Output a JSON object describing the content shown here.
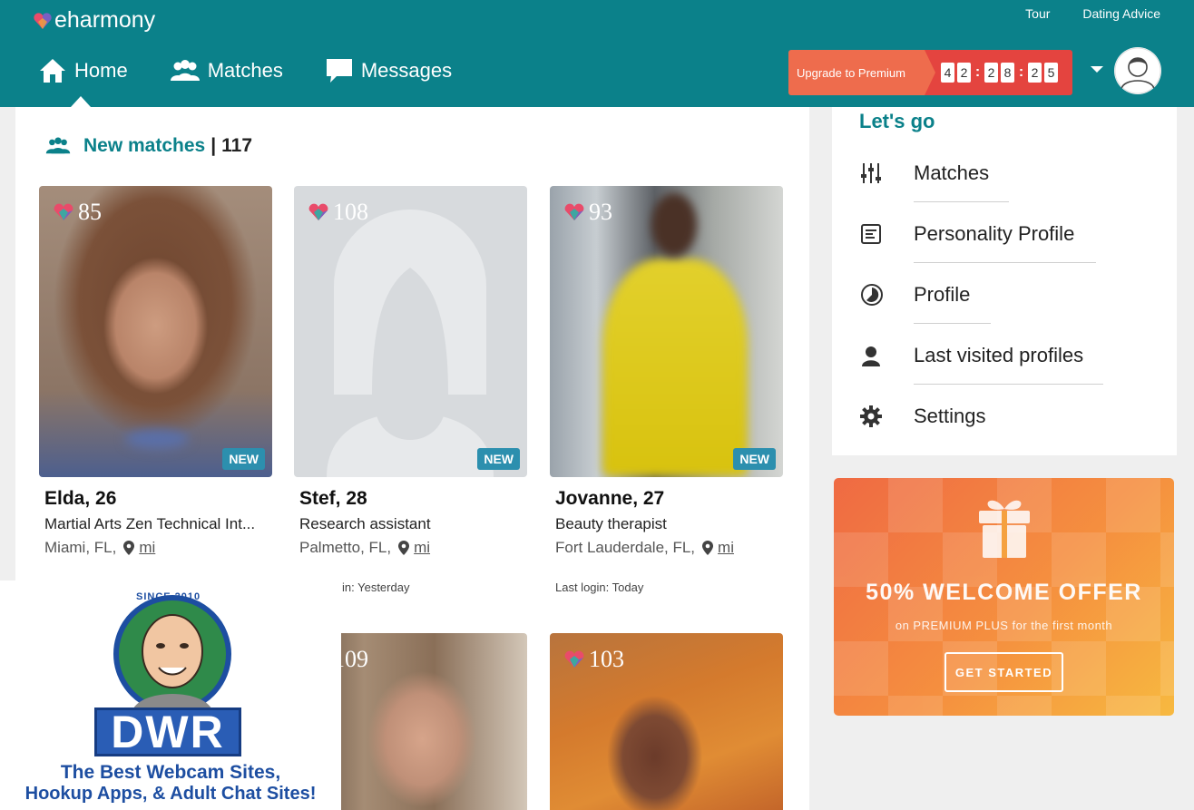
{
  "header": {
    "logo_text": "eharmony",
    "top_links": [
      "Tour",
      "Dating Advice"
    ],
    "nav": [
      {
        "label": "Home",
        "icon": "home-icon",
        "active": true
      },
      {
        "label": "Matches",
        "icon": "people-icon"
      },
      {
        "label": "Messages",
        "icon": "chat-icon"
      }
    ],
    "upgrade_label": "Upgrade to Premium",
    "timer_digits": [
      "4",
      "2",
      "2",
      "8",
      "2",
      "5"
    ],
    "colors": {
      "header_bg": "#0b818a",
      "upgrade_bg": "#ee6c4d",
      "timer_bg": "#e4443f"
    }
  },
  "new_matches": {
    "title": "New matches",
    "separator": "|",
    "count": "117",
    "cards": [
      {
        "score": "85",
        "name": "Elda, 26",
        "job": "Martial Arts Zen Technical Int...",
        "location": "Miami, FL,",
        "distance_unit": "mi",
        "badge": "NEW",
        "last_login": ""
      },
      {
        "score": "108",
        "name": "Stef, 28",
        "job": "Research assistant",
        "location": "Palmetto, FL,",
        "distance_unit": "mi",
        "badge": "NEW",
        "last_login": "in: Yesterday"
      },
      {
        "score": "93",
        "name": "Jovanne, 27",
        "job": "Beauty therapist",
        "location": "Fort Lauderdale, FL,",
        "distance_unit": "mi",
        "badge": "NEW",
        "last_login": "Last login: Today"
      },
      {
        "score": "109"
      },
      {
        "score": "103"
      }
    ]
  },
  "sidebar": {
    "title": "Let's go",
    "items": [
      {
        "label": "Matches",
        "icon": "sliders-icon"
      },
      {
        "label": "Personality Profile",
        "icon": "document-icon"
      },
      {
        "label": "Profile",
        "icon": "progress-circle-icon"
      },
      {
        "label": "Last visited profiles",
        "icon": "person-icon"
      },
      {
        "label": "Settings",
        "icon": "gear-icon"
      }
    ]
  },
  "offer": {
    "title": "50% WELCOME OFFER",
    "subtitle": "on PREMIUM PLUS for the first month",
    "button": "GET STARTED"
  },
  "watermark": {
    "since": "SINCE 2010",
    "brand": "DWR",
    "line1": "The Best Webcam Sites,",
    "line2": "Hookup Apps, & Adult Chat Sites!"
  }
}
